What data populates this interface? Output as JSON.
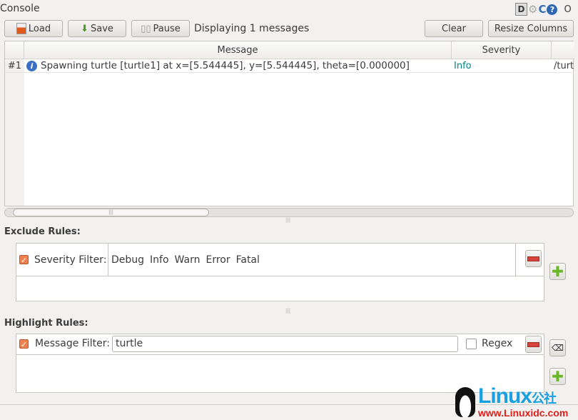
{
  "window": {
    "title": "Console",
    "title_icons": [
      "d-icon",
      "gear-icon",
      "refresh-icon",
      "help-icon"
    ],
    "extra": "O"
  },
  "toolbar": {
    "load": "Load",
    "save": "Save",
    "pause": "Pause",
    "status": "Displaying 1 messages",
    "clear": "Clear",
    "resize": "Resize Columns"
  },
  "table": {
    "headers": [
      "Message",
      "Severity"
    ],
    "rows": [
      {
        "num": "#1",
        "icon": "info-icon",
        "message": "Spawning turtle [turtle1] at x=[5.544445], y=[5.544445], theta=[0.000000]",
        "severity": "Info",
        "node": "/turtlesim"
      }
    ],
    "severity_color": "#00878a"
  },
  "exclude": {
    "title": "Exclude Rules:",
    "rules": [
      {
        "checked": true,
        "label": "Severity Filter:",
        "values": [
          "Debug",
          "Info",
          "Warn",
          "Error",
          "Fatal"
        ]
      }
    ]
  },
  "highlight": {
    "title": "Highlight Rules:",
    "rules": [
      {
        "checked": true,
        "label": "Message Filter:",
        "value": "turtle",
        "regex_label": "Regex",
        "regex": false
      }
    ]
  },
  "watermark": {
    "brand": "Linux公社",
    "url": "www.Linuxidc.com"
  }
}
